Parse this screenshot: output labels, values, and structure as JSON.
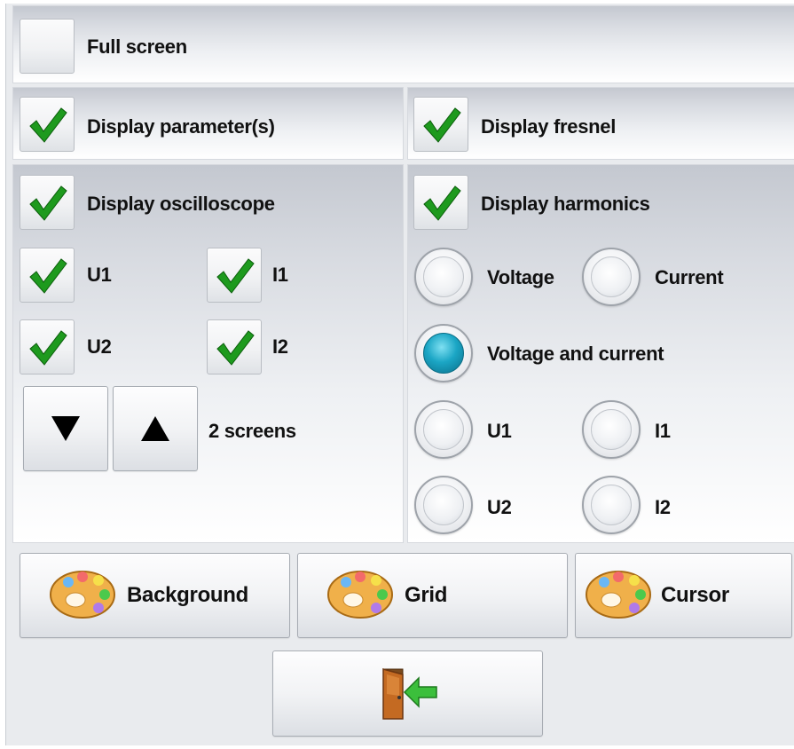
{
  "full_screen": {
    "label": "Full screen",
    "checked": false
  },
  "display_parameters": {
    "label": "Display parameter(s)",
    "checked": true
  },
  "display_fresnel": {
    "label": "Display fresnel",
    "checked": true
  },
  "oscilloscope": {
    "label": "Display oscilloscope",
    "checked": true,
    "channels": [
      {
        "label": "U1",
        "checked": true
      },
      {
        "label": "I1",
        "checked": true
      },
      {
        "label": "U2",
        "checked": true
      },
      {
        "label": "I2",
        "checked": true
      }
    ],
    "screens_label": "2 screens",
    "down_icon": "triangle-down-icon",
    "up_icon": "triangle-up-icon"
  },
  "harmonics": {
    "label": "Display harmonics",
    "checked": true,
    "mode_options": [
      {
        "label": "Voltage",
        "selected": false
      },
      {
        "label": "Current",
        "selected": false
      },
      {
        "label": "Voltage and current",
        "selected": true
      }
    ],
    "channels": [
      {
        "label": "U1",
        "selected": false
      },
      {
        "label": "I1",
        "selected": false
      },
      {
        "label": "U2",
        "selected": false
      },
      {
        "label": "I2",
        "selected": false
      }
    ]
  },
  "colors": {
    "background_label": "Background",
    "grid_label": "Grid",
    "cursor_label": "Cursor",
    "icon": "palette-icon"
  },
  "exit": {
    "icon": "exit-door-icon"
  },
  "theme": {
    "check_green": "#1e9a1e",
    "radio_on": "#1ba6c5"
  }
}
